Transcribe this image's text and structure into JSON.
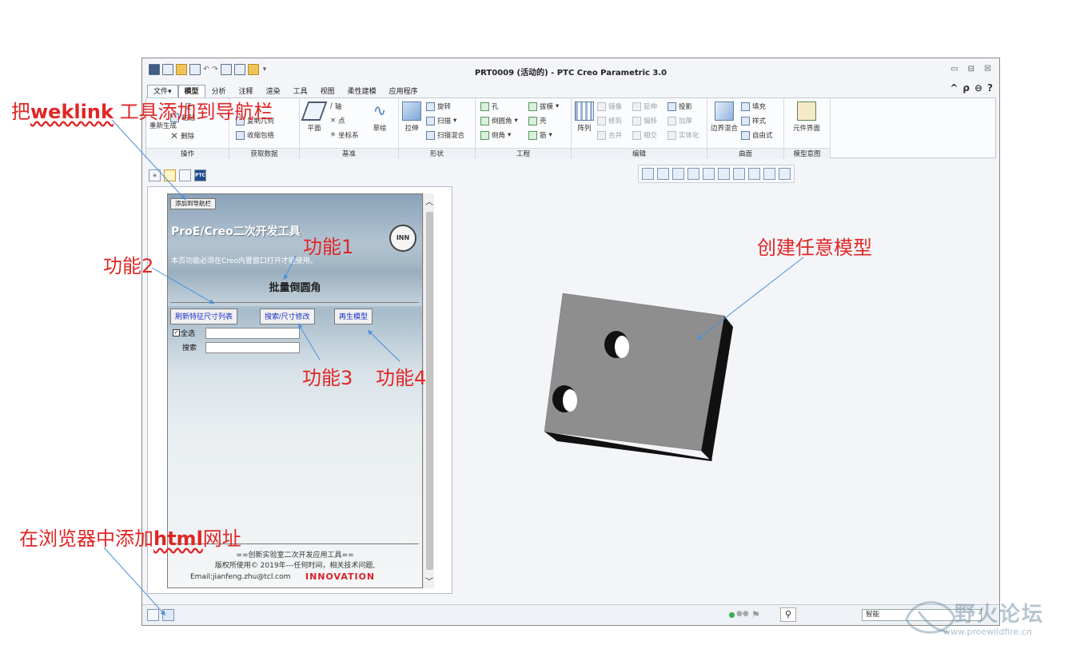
{
  "window": {
    "title": "PRT0009 (活动的) - PTC Creo Parametric 3.0",
    "controls": [
      "▭",
      "⊟",
      "☒"
    ]
  },
  "tabs": [
    "文件",
    "模型",
    "分析",
    "注释",
    "渲染",
    "工具",
    "视图",
    "柔性建模",
    "应用程序"
  ],
  "help_icons": [
    "^",
    "ρ",
    "⊖",
    "?"
  ],
  "ribbon": {
    "groups": [
      "操作",
      "获取数据",
      "基准",
      "形状",
      "工程",
      "编辑",
      "曲面",
      "模型意图"
    ],
    "operations": {
      "regen": "重新生成",
      "delete": "删除",
      "paste": "粘贴",
      "feature": "征"
    },
    "get_data": {
      "copy_geom": "复制几何",
      "shrinkwrap": "收缩包络"
    },
    "datum": {
      "plane": "平面",
      "axis": "轴",
      "point": "点",
      "csys": "坐标系",
      "sketch": "草绘"
    },
    "shape": {
      "extrude": "拉伸",
      "revolve": "旋转",
      "sweep": "扫描",
      "swept_blend": "扫描混合"
    },
    "engineering": {
      "hole": "孔",
      "round": "倒圆角",
      "chamfer": "倒角",
      "draft": "拔模",
      "shell": "壳",
      "rib": "筋"
    },
    "edit": {
      "pattern": "阵列",
      "mirror": "镜像",
      "trim": "修剪",
      "merge": "合并",
      "extend": "延伸",
      "offset": "偏移",
      "intersect": "相交",
      "project": "投影",
      "thicken": "加厚",
      "solidify": "实体化"
    },
    "surfaces": {
      "boundary_blend": "边界混合",
      "fill": "填充",
      "style": "样式",
      "freestyle": "自由式"
    },
    "model_intent": {
      "component_interface": "元件界面"
    }
  },
  "nav_tabs": [
    "model-tree",
    "folder",
    "favorites",
    "PTC"
  ],
  "webpage": {
    "add_button": "添加到导航栏",
    "title": "ProE/Creo二次开发工具",
    "logo": "INN",
    "description": "本页功能必须在Creo内置窗口打开才能使用。",
    "function_name": "批量倒圆角",
    "buttons": [
      "刷新特征尺寸列表",
      "搜索/尺寸修改",
      "再生模型"
    ],
    "select_all": "全选",
    "search_label": "搜索",
    "footer_line1": "==创新实验室二次开发应用工具==",
    "footer_line2": "版权所使用© 2019年---任何时间，相关技术问题,",
    "footer_email": "Email:jianfeng.zhu@tcl.com",
    "footer_brand": "INNOVATION"
  },
  "statusbar": {
    "filter": "智能"
  },
  "annotations": {
    "add_to_nav": {
      "pre": "把",
      "link": "weklink",
      "post": " 工具添加到导航栏"
    },
    "func1": "功能1",
    "func2": "功能2",
    "func3": "功能3",
    "func4": "功能4",
    "create_model": "创建任意模型",
    "add_url": {
      "pre": "在浏览器中添加",
      "link": "html",
      "post": "网址"
    }
  },
  "watermark": {
    "text": "野火论坛",
    "url": "www.proewildfire.cn"
  },
  "colors": {
    "annotation": "#e02626",
    "arrow": "#4a90d9",
    "part_face": "#8c8c8c",
    "part_side": "#111111"
  }
}
